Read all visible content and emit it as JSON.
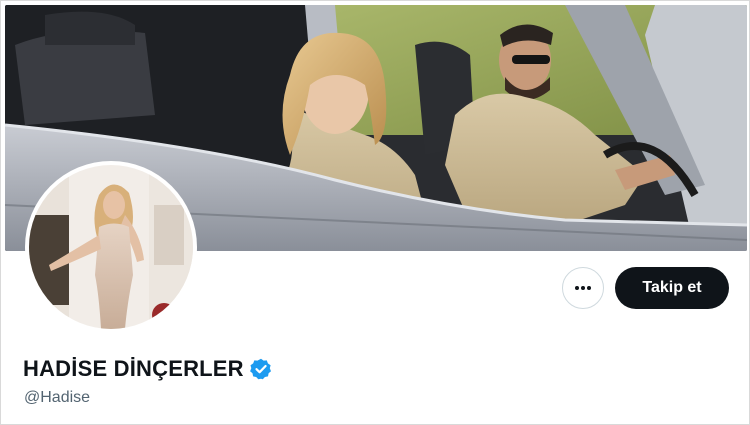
{
  "profile": {
    "display_name": "HADİSE DİNÇERLER",
    "handle": "@Hadise",
    "verified": true
  },
  "actions": {
    "more_icon": "more-horizontal-icon",
    "follow_label": "Takip et"
  },
  "colors": {
    "follow_button_bg": "#0f1419",
    "follow_button_text": "#ffffff",
    "verified_badge": "#1d9bf0",
    "handle_text": "#536471",
    "name_text": "#0f1419"
  },
  "images": {
    "banner": "banner-photo",
    "avatar": "avatar-photo"
  }
}
